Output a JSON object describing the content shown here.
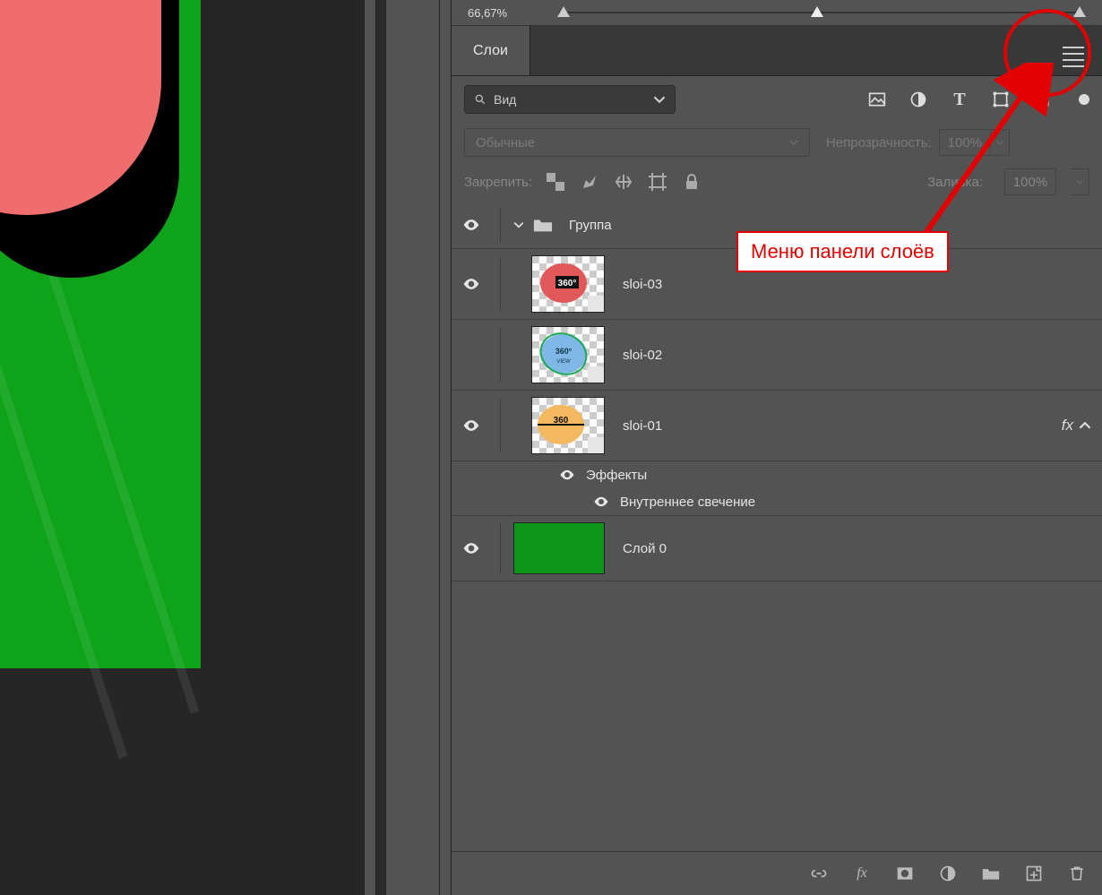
{
  "zoom": "66,67%",
  "panel_tab": "Слои",
  "search_label": "Вид",
  "blend_mode": "Обычные",
  "opacity_label": "Непрозрачность:",
  "opacity_value": "100%",
  "lock_label": "Закрепить:",
  "fill_label": "Заливка:",
  "fill_value": "100%",
  "group_name": "Группа",
  "layers": [
    {
      "name": "sloi-03"
    },
    {
      "name": "sloi-02"
    },
    {
      "name": "sloi-01"
    }
  ],
  "effects_label": "Эффекты",
  "effect_inner_glow": "Внутреннее свечение",
  "fx_badge": "fx",
  "base_layer": "Слой 0",
  "annotation": "Меню панели слоёв",
  "icons": {
    "search": "search-icon",
    "image_filter": "image-filter-icon",
    "adjust_filter": "adjustment-filter-icon",
    "text_filter": "text-filter-icon",
    "shape_filter": "shape-filter-icon",
    "smart_filter": "smartobject-filter-icon"
  }
}
